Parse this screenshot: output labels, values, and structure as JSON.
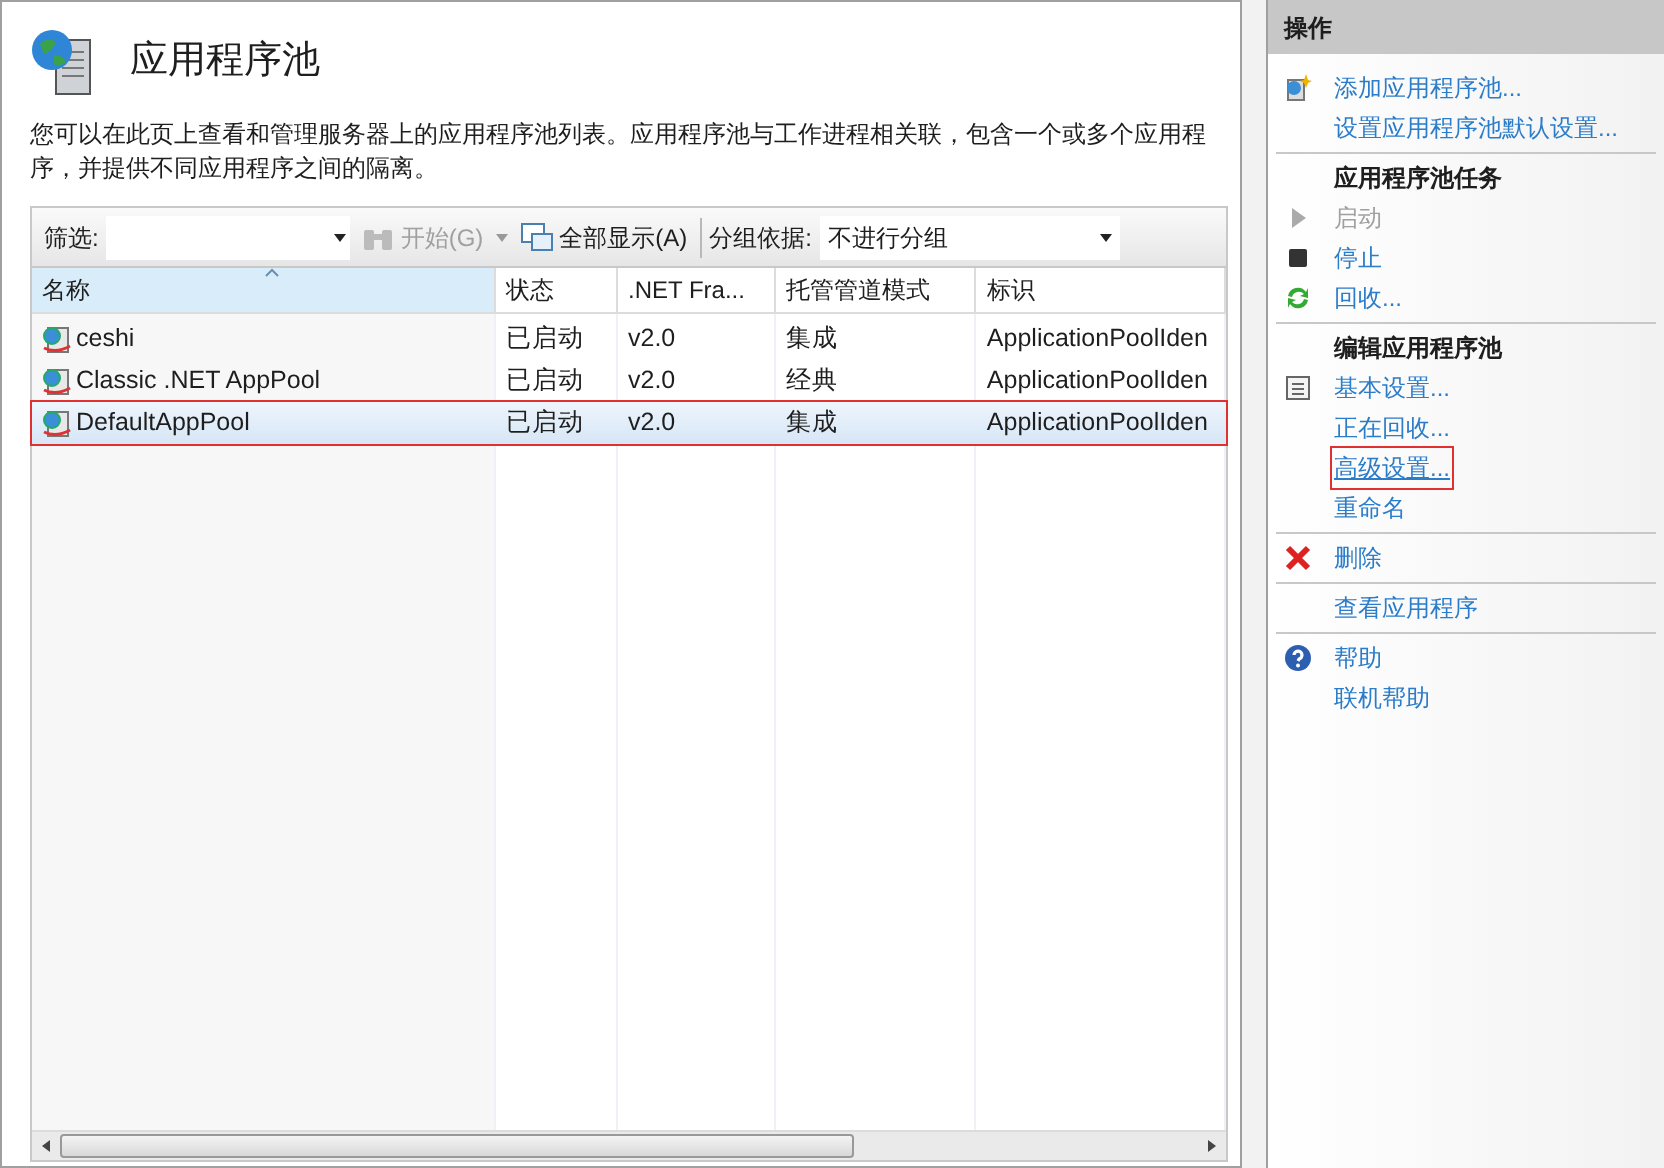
{
  "page": {
    "title": "应用程序池",
    "description": "您可以在此页上查看和管理服务器上的应用程序池列表。应用程序池与工作进程相关联，包含一个或多个应用程序，并提供不同应用程序之间的隔离。"
  },
  "toolbar": {
    "filter_label": "筛选:",
    "start_button": "开始(G)",
    "show_all_button": "全部显示(A)",
    "group_label": "分组依据:",
    "group_value": "不进行分组"
  },
  "table": {
    "columns": [
      {
        "label": "名称",
        "sorted": true
      },
      {
        "label": "状态",
        "sorted": false
      },
      {
        "label": ".NET Fra...",
        "sorted": false
      },
      {
        "label": "托管管道模式",
        "sorted": false
      },
      {
        "label": "标识",
        "sorted": false
      }
    ],
    "rows": [
      {
        "cells": [
          "ceshi",
          "已启动",
          "v2.0",
          "集成",
          "ApplicationPoolIden"
        ],
        "selected": false,
        "highlighted": false
      },
      {
        "cells": [
          "Classic .NET AppPool",
          "已启动",
          "v2.0",
          "经典",
          "ApplicationPoolIden"
        ],
        "selected": false,
        "highlighted": false
      },
      {
        "cells": [
          "DefaultAppPool",
          "已启动",
          "v2.0",
          "集成",
          "ApplicationPoolIden"
        ],
        "selected": true,
        "highlighted": true
      }
    ]
  },
  "actions": {
    "title": "操作",
    "groups": [
      {
        "items": [
          {
            "kind": "link",
            "label": "添加应用程序池...",
            "highlighted": false
          },
          {
            "kind": "link",
            "label": "设置应用程序池默认设置...",
            "highlighted": false
          }
        ]
      },
      {
        "items": [
          {
            "kind": "header",
            "label": "应用程序池任务",
            "highlighted": false
          },
          {
            "kind": "disabled",
            "label": "启动",
            "highlighted": false
          },
          {
            "kind": "link",
            "label": "停止",
            "highlighted": false
          },
          {
            "kind": "link",
            "label": "回收...",
            "highlighted": false
          }
        ]
      },
      {
        "items": [
          {
            "kind": "header",
            "label": "编辑应用程序池",
            "highlighted": false
          },
          {
            "kind": "link",
            "label": "基本设置...",
            "highlighted": false
          },
          {
            "kind": "link",
            "label": "正在回收...",
            "highlighted": false
          },
          {
            "kind": "link",
            "label": "高级设置...",
            "highlighted": true
          },
          {
            "kind": "link",
            "label": "重命名",
            "highlighted": false
          }
        ]
      },
      {
        "items": [
          {
            "kind": "link",
            "label": "删除",
            "highlighted": false
          }
        ]
      },
      {
        "items": [
          {
            "kind": "link",
            "label": "查看应用程序",
            "highlighted": false
          }
        ]
      },
      {
        "items": [
          {
            "kind": "link",
            "label": "帮助",
            "highlighted": false
          },
          {
            "kind": "link",
            "label": "联机帮助",
            "highlighted": false
          }
        ]
      }
    ]
  }
}
